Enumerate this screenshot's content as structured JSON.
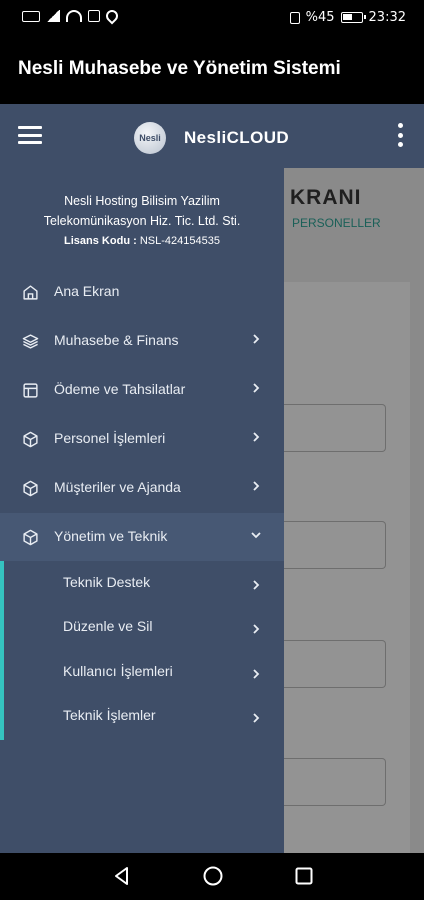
{
  "status_bar": {
    "left_icons": [
      "sim-icon",
      "signal-icon",
      "wifi-icon",
      "nfc-icon",
      "location-icon"
    ],
    "battery_text": "%45",
    "time": "23:32"
  },
  "app": {
    "title": "Nesli Muhasebe ve Yönetim Sistemi"
  },
  "toolbar": {
    "logo_text": "Nesli",
    "brand": "NesliCLOUD"
  },
  "background_page": {
    "title": "KRANI",
    "tab": "PERSONELLER"
  },
  "drawer": {
    "company_line1": "Nesli Hosting Bilisim Yazilim",
    "company_line2": "Telekomünikasyon Hiz. Tic. Ltd. Sti.",
    "license_label": "Lisans Kodu :",
    "license_code": "NSL-424154535",
    "menu": [
      {
        "label": "Ana Ekran",
        "icon": "home-icon"
      },
      {
        "label": "Muhasebe & Finans",
        "icon": "layers-icon"
      },
      {
        "label": "Ödeme ve Tahsilatlar",
        "icon": "layout-icon"
      },
      {
        "label": "Personel İşlemleri",
        "icon": "cube-icon"
      },
      {
        "label": "Müşteriler ve Ajanda",
        "icon": "cube-icon"
      },
      {
        "label": "Yönetim ve Teknik",
        "icon": "cube-icon"
      }
    ],
    "submenu": [
      {
        "label": "Teknik Destek"
      },
      {
        "label": "Düzenle ve Sil"
      },
      {
        "label": "Kullanıcı İşlemleri"
      },
      {
        "label": "Teknik İşlemler"
      }
    ]
  },
  "colors": {
    "drawer_bg": "#3f4e68",
    "accent": "#35c3c0"
  }
}
